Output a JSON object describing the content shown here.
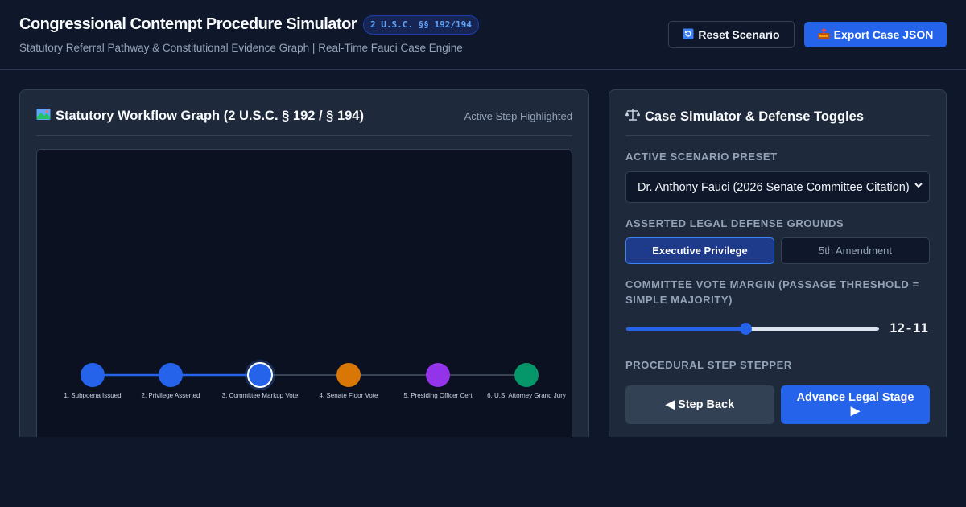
{
  "header": {
    "title": "Congressional Contempt Procedure Simulator",
    "badge": "2 U.S.C. §§ 192/194",
    "subtitle": "Statutory Referral Pathway & Constitutional Evidence Graph | Real-Time Fauci Case Engine",
    "reset_label": "Reset Scenario",
    "export_label": "Export Case JSON",
    "reset_icon": "refresh-icon",
    "export_icon": "outbox-tray-icon"
  },
  "workflow": {
    "title": "Statutory Workflow Graph (2 U.S.C. § 192 / § 194)",
    "title_icon": "map-icon",
    "note": "Active Step Highlighted",
    "active_step_index": 2,
    "steps": [
      {
        "label": "1. Subpoena Issued",
        "color": "#2563eb"
      },
      {
        "label": "2. Privilege Asserted",
        "color": "#2563eb"
      },
      {
        "label": "3. Committee Markup Vote",
        "color": "#2563eb"
      },
      {
        "label": "4. Senate Floor Vote",
        "color": "#d97706"
      },
      {
        "label": "5. Presiding Officer Cert",
        "color": "#9333ea"
      },
      {
        "label": "6. U.S. Attorney Grand Jury",
        "color": "#059669"
      }
    ],
    "completed_link_color": "#2563eb",
    "pending_link_color": "#475569"
  },
  "simulator": {
    "title": "Case Simulator & Defense Toggles",
    "title_icon": "balance-scale-icon",
    "preset_label": "Active Scenario Preset",
    "preset_value": "Dr. Anthony Fauci (2026 Senate Committee Citation)",
    "defense_label": "Asserted Legal Defense Grounds",
    "defense_options": [
      "Executive Privilege",
      "5th Amendment"
    ],
    "defense_selected": "Executive Privilege",
    "vote_label": "Committee Vote Margin (Passage Threshold = Simple Majority)",
    "vote_value": "12-11",
    "vote_fraction": 0.47,
    "stepper_label": "Procedural Step Stepper",
    "back_label": "◀ Step Back",
    "advance_label": "Advance Legal Stage ▶"
  },
  "colors": {
    "background": "#0f172a",
    "panel": "#1e293b",
    "accent": "#2563eb",
    "badge_text": "#60a5fa"
  }
}
